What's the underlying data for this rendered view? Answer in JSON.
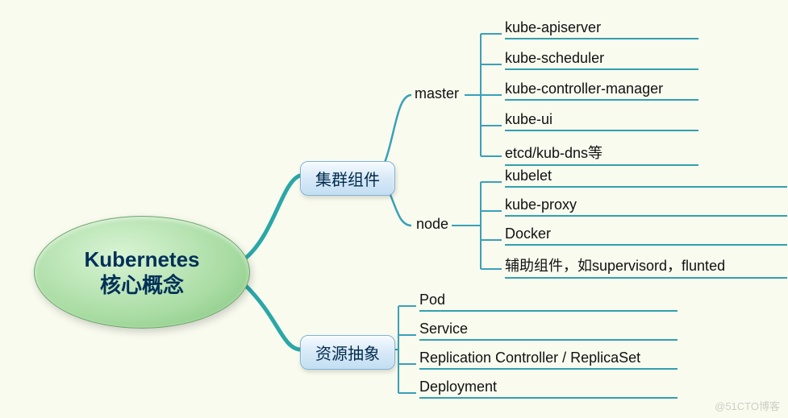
{
  "root": {
    "line1": "Kubernetes",
    "line2": "核心概念"
  },
  "branches": {
    "cluster": {
      "label": "集群组件",
      "master": {
        "label": "master",
        "items": [
          "kube-apiserver",
          "kube-scheduler",
          "kube-controller-manager",
          "kube-ui",
          "etcd/kub-dns等"
        ]
      },
      "node": {
        "label": "node",
        "items": [
          "kubelet",
          "kube-proxy",
          "Docker",
          "辅助组件，如supervisord，flunted"
        ]
      }
    },
    "resource": {
      "label": "资源抽象",
      "items": [
        "Pod",
        "Service",
        "Replication Controller / ReplicaSet",
        "Deployment"
      ]
    }
  },
  "watermark": "@51CTO博客",
  "colors": {
    "connector_teal": "#2aa7a7",
    "connector_blue": "#3aa0b8",
    "leaf_underline": "#32a0ad"
  }
}
